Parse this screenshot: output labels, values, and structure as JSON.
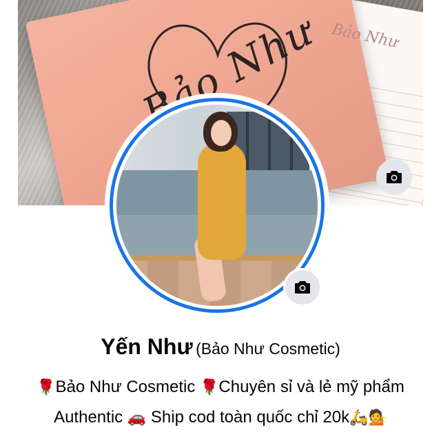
{
  "cover": {
    "brand_script": "Bảo Như",
    "brand_small": "Bảo Như",
    "camera_icon": "camera-icon"
  },
  "profile": {
    "camera_icon": "camera-icon",
    "name": "Yến Như",
    "alternate_name": "(Bảo Như Cosmetic)"
  },
  "bio": {
    "line1_part1": "Bảo Như Cosmetic",
    "line1_part2": "Chuyên sỉ và lẻ mỹ phẩm",
    "line2_part1": "Authentic",
    "line2_part2": "Ship cod toàn quốc chỉ 20k",
    "emoji_rose": "🌹",
    "emoji_car": "🚗",
    "emoji_scooter": "🛵",
    "emoji_person": "💁"
  }
}
